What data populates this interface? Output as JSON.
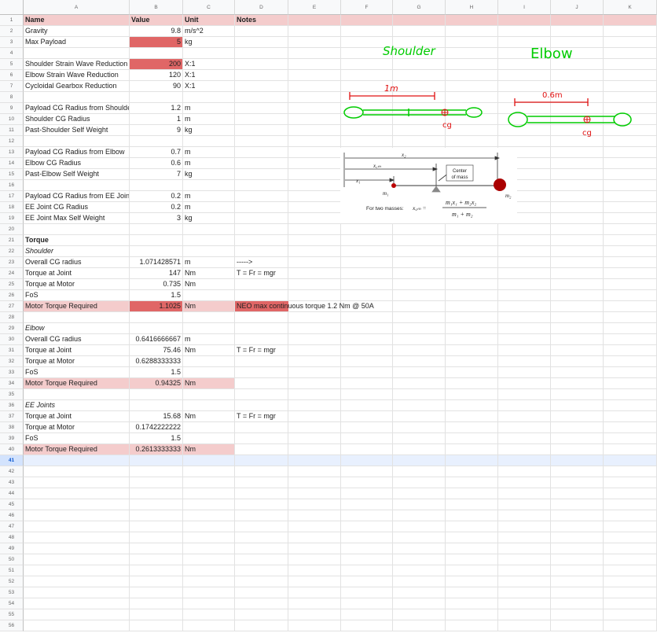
{
  "columns": [
    "A",
    "B",
    "C",
    "D",
    "E",
    "F",
    "G",
    "H",
    "I",
    "J",
    "K"
  ],
  "rows": [
    {
      "n": "1",
      "cells": [
        {
          "c": "A",
          "t": "Name",
          "cls": "b"
        },
        {
          "c": "B",
          "t": "Value",
          "cls": "b"
        },
        {
          "c": "C",
          "t": "Unit",
          "cls": "b"
        },
        {
          "c": "D",
          "t": "Notes",
          "cls": "b"
        }
      ],
      "header": true
    },
    {
      "n": "2",
      "cells": [
        {
          "c": "A",
          "t": "Gravity"
        },
        {
          "c": "B",
          "t": "9.8",
          "cls": "r"
        },
        {
          "c": "C",
          "t": "m/s^2"
        }
      ]
    },
    {
      "n": "3",
      "cells": [
        {
          "c": "A",
          "t": "Max Payload"
        },
        {
          "c": "B",
          "t": "5",
          "cls": "r red"
        },
        {
          "c": "C",
          "t": "kg"
        }
      ]
    },
    {
      "n": "4",
      "cells": []
    },
    {
      "n": "5",
      "cells": [
        {
          "c": "A",
          "t": "Shoulder Strain Wave Reduction"
        },
        {
          "c": "B",
          "t": "200",
          "cls": "r red"
        },
        {
          "c": "C",
          "t": "X:1"
        }
      ]
    },
    {
      "n": "6",
      "cells": [
        {
          "c": "A",
          "t": "Elbow Strain Wave Reduction"
        },
        {
          "c": "B",
          "t": "120",
          "cls": "r"
        },
        {
          "c": "C",
          "t": "X:1"
        }
      ]
    },
    {
      "n": "7",
      "cells": [
        {
          "c": "A",
          "t": "Cycloidal Gearbox Reduction"
        },
        {
          "c": "B",
          "t": "90",
          "cls": "r"
        },
        {
          "c": "C",
          "t": "X:1"
        }
      ]
    },
    {
      "n": "8",
      "cells": []
    },
    {
      "n": "9",
      "cells": [
        {
          "c": "A",
          "t": "Payload CG Radius from Shoulde"
        },
        {
          "c": "B",
          "t": "1.2",
          "cls": "r"
        },
        {
          "c": "C",
          "t": "m"
        }
      ]
    },
    {
      "n": "10",
      "cells": [
        {
          "c": "A",
          "t": "Shoulder CG Radius"
        },
        {
          "c": "B",
          "t": "1",
          "cls": "r"
        },
        {
          "c": "C",
          "t": "m"
        }
      ]
    },
    {
      "n": "11",
      "cells": [
        {
          "c": "A",
          "t": "Past-Shoulder Self Weight"
        },
        {
          "c": "B",
          "t": "9",
          "cls": "r"
        },
        {
          "c": "C",
          "t": "kg"
        }
      ]
    },
    {
      "n": "12",
      "cells": []
    },
    {
      "n": "13",
      "cells": [
        {
          "c": "A",
          "t": "Payload CG Radius from Elbow"
        },
        {
          "c": "B",
          "t": "0.7",
          "cls": "r"
        },
        {
          "c": "C",
          "t": "m"
        }
      ]
    },
    {
      "n": "14",
      "cells": [
        {
          "c": "A",
          "t": "Elbow CG Radius"
        },
        {
          "c": "B",
          "t": "0.6",
          "cls": "r"
        },
        {
          "c": "C",
          "t": "m"
        }
      ]
    },
    {
      "n": "15",
      "cells": [
        {
          "c": "A",
          "t": "Past-Elbow Self Weight"
        },
        {
          "c": "B",
          "t": "7",
          "cls": "r"
        },
        {
          "c": "C",
          "t": "kg"
        }
      ]
    },
    {
      "n": "16",
      "cells": []
    },
    {
      "n": "17",
      "cells": [
        {
          "c": "A",
          "t": "Payload CG Radius from EE Join"
        },
        {
          "c": "B",
          "t": "0.2",
          "cls": "r"
        },
        {
          "c": "C",
          "t": "m"
        }
      ]
    },
    {
      "n": "18",
      "cells": [
        {
          "c": "A",
          "t": "EE Joint CG Radius"
        },
        {
          "c": "B",
          "t": "0.2",
          "cls": "r"
        },
        {
          "c": "C",
          "t": "m"
        }
      ]
    },
    {
      "n": "19",
      "cells": [
        {
          "c": "A",
          "t": "EE Joint Max Self Weight"
        },
        {
          "c": "B",
          "t": "3",
          "cls": "r"
        },
        {
          "c": "C",
          "t": "kg"
        }
      ]
    },
    {
      "n": "20",
      "cells": []
    },
    {
      "n": "21",
      "cells": [
        {
          "c": "A",
          "t": "Torque",
          "cls": "b"
        }
      ]
    },
    {
      "n": "22",
      "cells": [
        {
          "c": "A",
          "t": "Shoulder",
          "cls": "i"
        }
      ]
    },
    {
      "n": "23",
      "cells": [
        {
          "c": "A",
          "t": "Overall CG radius"
        },
        {
          "c": "B",
          "t": "1.071428571",
          "cls": "r"
        },
        {
          "c": "C",
          "t": "m"
        },
        {
          "c": "D",
          "t": "----->"
        }
      ]
    },
    {
      "n": "24",
      "cells": [
        {
          "c": "A",
          "t": "Torque at Joint"
        },
        {
          "c": "B",
          "t": "147",
          "cls": "r"
        },
        {
          "c": "C",
          "t": "Nm"
        },
        {
          "c": "D",
          "t": "T = Fr = mgr"
        }
      ]
    },
    {
      "n": "25",
      "cells": [
        {
          "c": "A",
          "t": "Torque at Motor"
        },
        {
          "c": "B",
          "t": "0.735",
          "cls": "r"
        },
        {
          "c": "C",
          "t": "Nm"
        }
      ]
    },
    {
      "n": "26",
      "cells": [
        {
          "c": "A",
          "t": "FoS"
        },
        {
          "c": "B",
          "t": "1.5",
          "cls": "r"
        }
      ]
    },
    {
      "n": "27",
      "cells": [
        {
          "c": "A",
          "t": "Motor Torque Required",
          "cls": "pink"
        },
        {
          "c": "B",
          "t": "1.1025",
          "cls": "r red"
        },
        {
          "c": "C",
          "t": "Nm",
          "cls": "pink"
        },
        {
          "c": "D",
          "t": "NEO max continuous torque 1.2 Nm @ 50A",
          "cls": "vis red"
        }
      ]
    },
    {
      "n": "28",
      "cells": []
    },
    {
      "n": "29",
      "cells": [
        {
          "c": "A",
          "t": "Elbow",
          "cls": "i"
        }
      ]
    },
    {
      "n": "30",
      "cells": [
        {
          "c": "A",
          "t": "Overall CG radius"
        },
        {
          "c": "B",
          "t": "0.6416666667",
          "cls": "r"
        },
        {
          "c": "C",
          "t": "m"
        }
      ]
    },
    {
      "n": "31",
      "cells": [
        {
          "c": "A",
          "t": "Torque at Joint"
        },
        {
          "c": "B",
          "t": "75.46",
          "cls": "r"
        },
        {
          "c": "C",
          "t": "Nm"
        },
        {
          "c": "D",
          "t": "T = Fr = mgr"
        }
      ]
    },
    {
      "n": "32",
      "cells": [
        {
          "c": "A",
          "t": "Torque at Motor"
        },
        {
          "c": "B",
          "t": "0.6288333333",
          "cls": "r"
        }
      ]
    },
    {
      "n": "33",
      "cells": [
        {
          "c": "A",
          "t": "FoS"
        },
        {
          "c": "B",
          "t": "1.5",
          "cls": "r"
        }
      ]
    },
    {
      "n": "34",
      "cells": [
        {
          "c": "A",
          "t": "Motor Torque Required",
          "cls": "pink"
        },
        {
          "c": "B",
          "t": "0.94325",
          "cls": "r pink"
        },
        {
          "c": "C",
          "t": "Nm",
          "cls": "pink"
        }
      ]
    },
    {
      "n": "35",
      "cells": []
    },
    {
      "n": "36",
      "cells": [
        {
          "c": "A",
          "t": "EE Joints",
          "cls": "i"
        }
      ]
    },
    {
      "n": "37",
      "cells": [
        {
          "c": "A",
          "t": "Torque at Joint"
        },
        {
          "c": "B",
          "t": "15.68",
          "cls": "r"
        },
        {
          "c": "C",
          "t": "Nm"
        },
        {
          "c": "D",
          "t": "T = Fr = mgr"
        }
      ]
    },
    {
      "n": "38",
      "cells": [
        {
          "c": "A",
          "t": "Torque at Motor"
        },
        {
          "c": "B",
          "t": "0.1742222222",
          "cls": "r"
        }
      ]
    },
    {
      "n": "39",
      "cells": [
        {
          "c": "A",
          "t": "FoS"
        },
        {
          "c": "B",
          "t": "1.5",
          "cls": "r"
        }
      ]
    },
    {
      "n": "40",
      "cells": [
        {
          "c": "A",
          "t": "Motor Torque Required",
          "cls": "pink"
        },
        {
          "c": "B",
          "t": "0.2613333333",
          "cls": "r pink"
        },
        {
          "c": "C",
          "t": "Nm",
          "cls": "pink"
        }
      ]
    },
    {
      "n": "41",
      "cells": [],
      "selected": true
    },
    {
      "n": "42",
      "cells": []
    },
    {
      "n": "43",
      "cells": []
    },
    {
      "n": "44",
      "cells": []
    },
    {
      "n": "45",
      "cells": []
    },
    {
      "n": "46",
      "cells": []
    },
    {
      "n": "47",
      "cells": []
    },
    {
      "n": "48",
      "cells": []
    },
    {
      "n": "49",
      "cells": []
    },
    {
      "n": "50",
      "cells": []
    },
    {
      "n": "51",
      "cells": []
    },
    {
      "n": "52",
      "cells": []
    },
    {
      "n": "53",
      "cells": []
    },
    {
      "n": "54",
      "cells": []
    },
    {
      "n": "55",
      "cells": []
    },
    {
      "n": "56",
      "cells": []
    }
  ],
  "drawing": {
    "shoulder_label": "Shoulder",
    "elbow_label": "Elbow",
    "shoulder_length": "1m",
    "elbow_length": "0.6m",
    "cg_label": "cg",
    "stroke_color": "#00cc00",
    "annotation_color": "#e01010"
  },
  "cm_diagram": {
    "x2": "x₂",
    "xcm": "x꜀ₘ",
    "x1": "x₁",
    "m1": "m₁",
    "m2": "m₂",
    "center_label_1": "Center",
    "center_label_2": "of mass",
    "caption": "For two masses:",
    "formula_lhs": "x꜀ₘ =",
    "numerator": "m₁x₁ + m₂x₂",
    "denominator": "m₁ + m₂"
  },
  "colors": {
    "header_fill": "#f4cccc",
    "highlight_red": "#e06666",
    "selected_row": "#d3e3fd"
  }
}
